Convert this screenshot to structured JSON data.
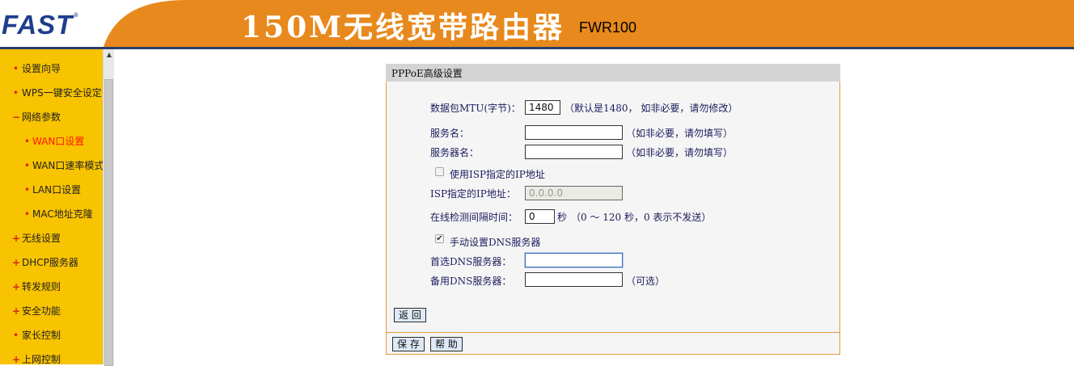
{
  "header": {
    "logo_text": "FAST",
    "logo_mark": "®",
    "product_title": "150M无线宽带路由器",
    "model": "FWR100"
  },
  "colors": {
    "header_orange": "#e8891d",
    "header_line": "#2a3f6d",
    "sidebar_bg": "#f8c300",
    "active_item": "#ff1a00",
    "panel_border": "#e39a3b"
  },
  "sidebar": {
    "items": [
      {
        "label": "设置向导",
        "bullet": "•"
      },
      {
        "label": "WPS一键安全设定",
        "bullet": "•"
      },
      {
        "label": "网络参数",
        "bullet": "−"
      },
      {
        "label": "WAN口设置",
        "bullet": "•"
      },
      {
        "label": "WAN口速率模式",
        "bullet": "•"
      },
      {
        "label": "LAN口设置",
        "bullet": "•"
      },
      {
        "label": "MAC地址克隆",
        "bullet": "•"
      },
      {
        "label": "无线设置",
        "bullet": "+"
      },
      {
        "label": "DHCP服务器",
        "bullet": "+"
      },
      {
        "label": "转发规则",
        "bullet": "+"
      },
      {
        "label": "安全功能",
        "bullet": "+"
      },
      {
        "label": "家长控制",
        "bullet": "•"
      },
      {
        "label": "上网控制",
        "bullet": "+"
      }
    ],
    "scroll_up_icon": "▲"
  },
  "panel": {
    "title": "PPPoE高级设置",
    "mtu": {
      "label": "数据包MTU(字节)：",
      "value": "1480",
      "hint": "（默认是1480， 如非必要，请勿修改）"
    },
    "service_name": {
      "label": "服务名：",
      "value": "",
      "hint": "（如非必要，请勿填写）"
    },
    "server_name": {
      "label": "服务器名：",
      "value": "",
      "hint": "（如非必要，请勿填写）"
    },
    "use_isp_ip": {
      "label": "使用ISP指定的IP地址",
      "checked": false
    },
    "isp_ip": {
      "label": "ISP指定的IP地址：",
      "value": "0.0.0.0"
    },
    "online_check": {
      "label": "在线检测间隔时间：",
      "value": "0",
      "unit": "秒",
      "hint": "（0 ～ 120 秒，0 表示不发送）"
    },
    "manual_dns": {
      "label": "手动设置DNS服务器",
      "checked": true,
      "check_glyph": "✔"
    },
    "primary_dns": {
      "label": "首选DNS服务器：",
      "value": ""
    },
    "secondary_dns": {
      "label": "备用DNS服务器：",
      "value": "",
      "hint": "（可选）"
    },
    "back_button": "返 回",
    "save_button": "保 存",
    "help_button": "帮 助"
  }
}
